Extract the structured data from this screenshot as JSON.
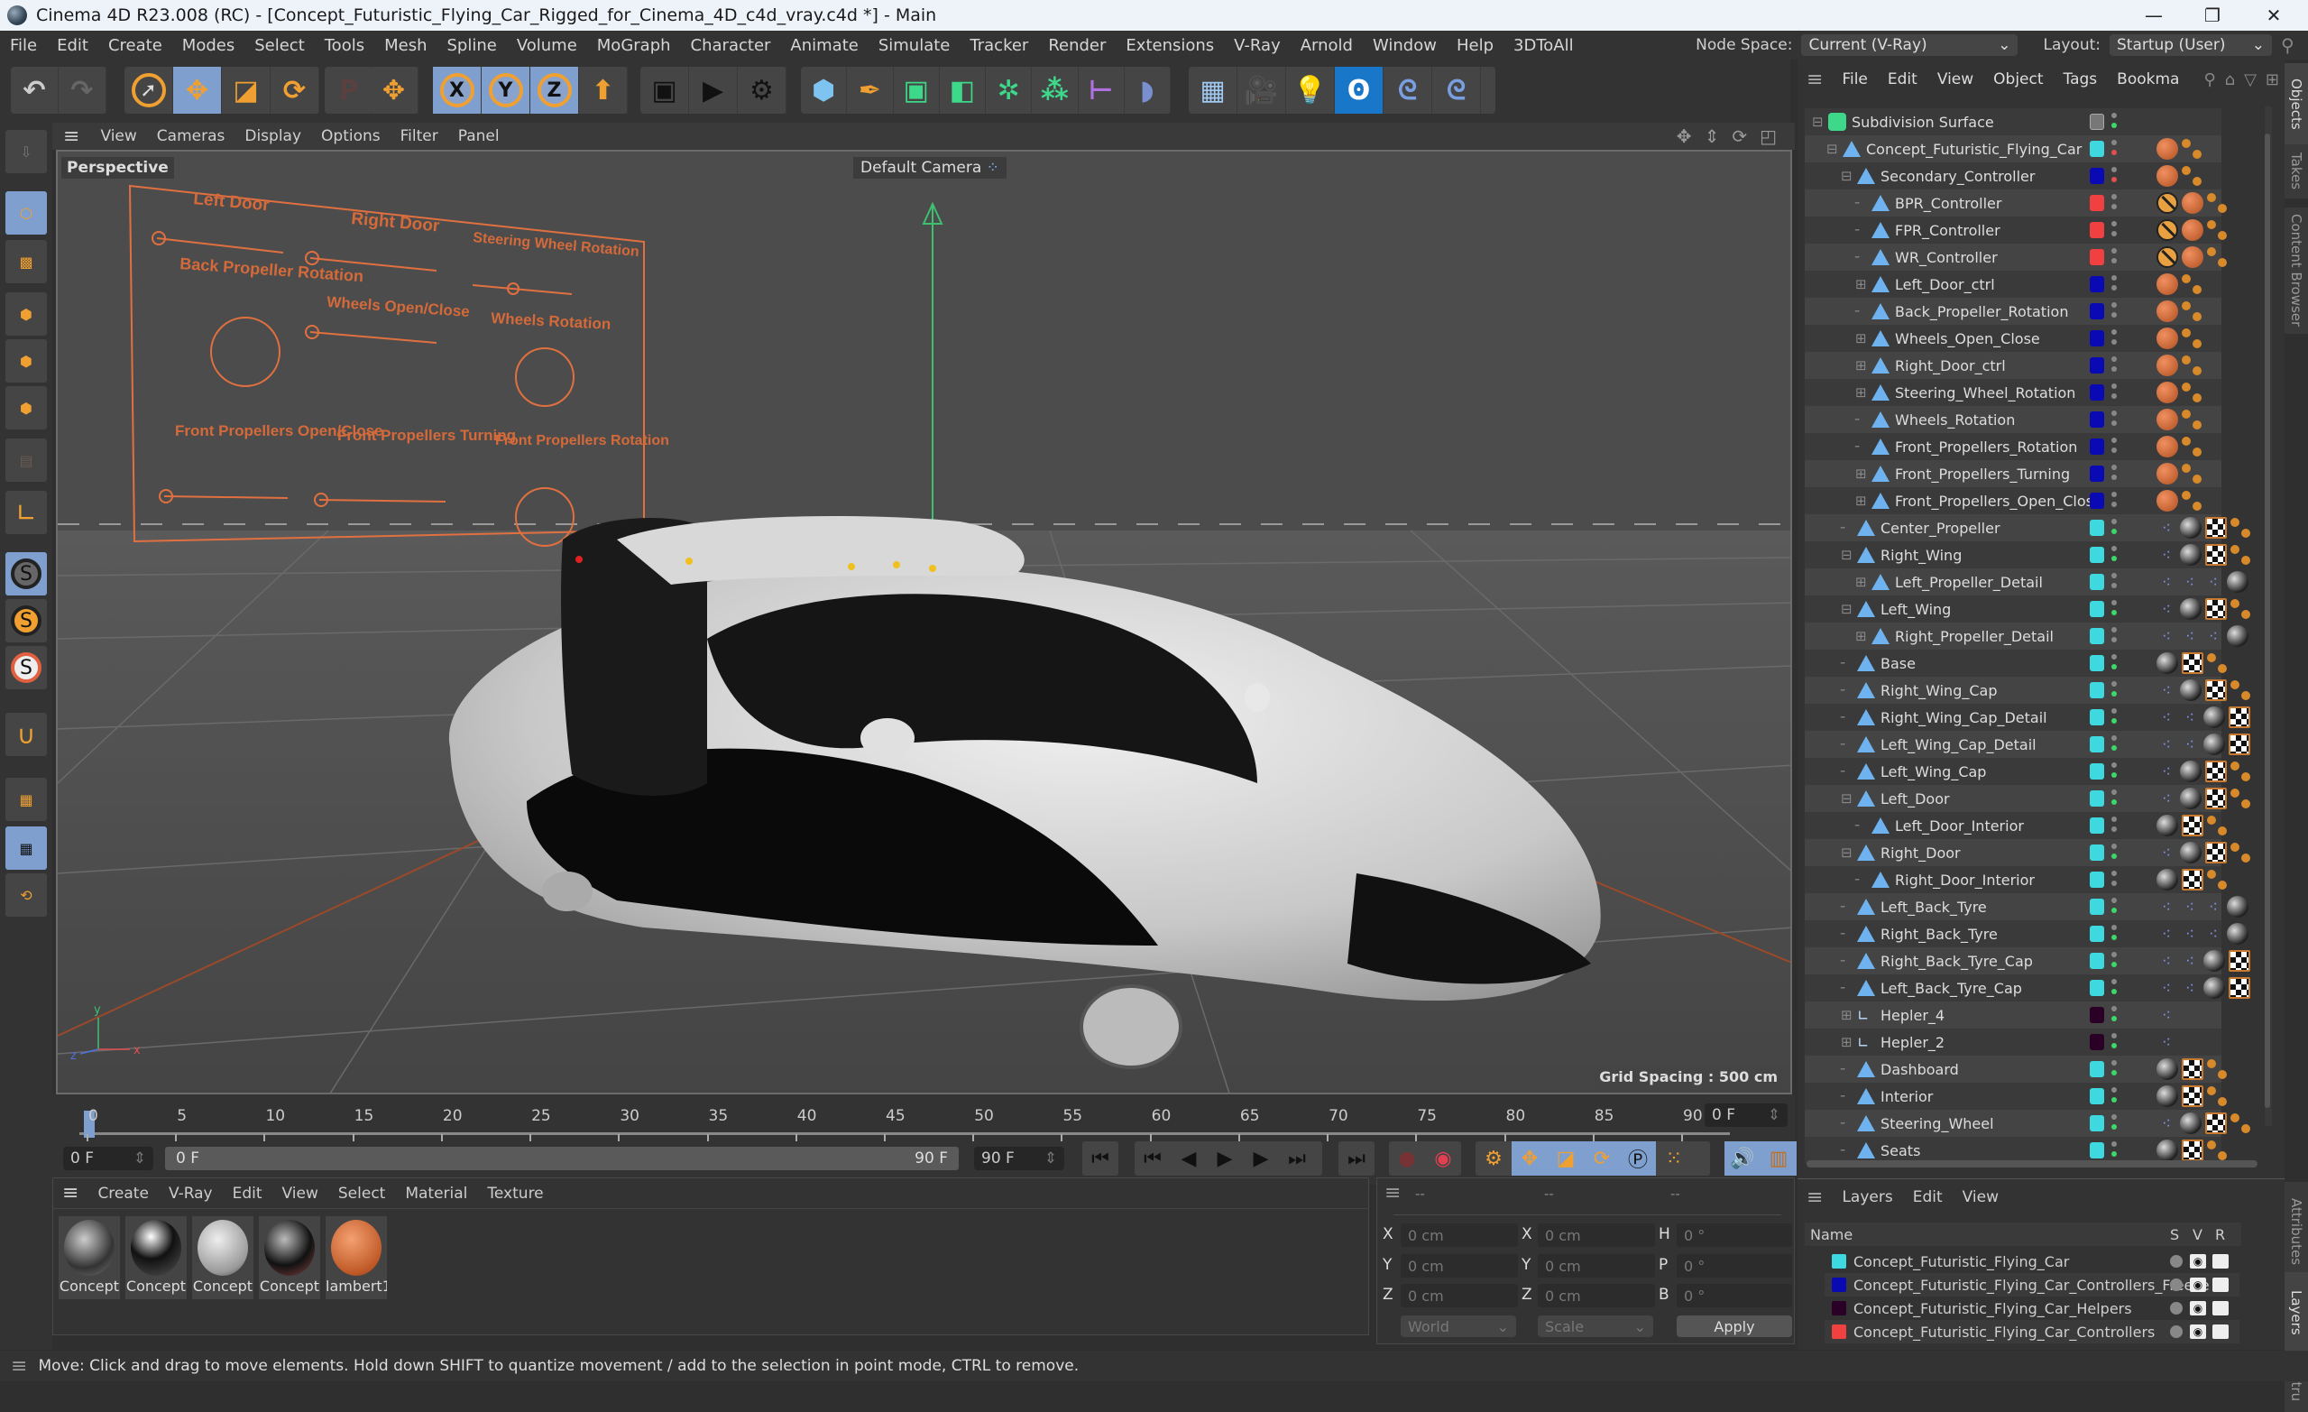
{
  "window": {
    "title": "Cinema 4D R23.008 (RC) - [Concept_Futuristic_Flying_Car_Rigged_for_Cinema_4D_c4d_vray.c4d *] - Main",
    "minimize": "—",
    "restore": "❐",
    "close": "✕"
  },
  "menubar": {
    "items": [
      "File",
      "Edit",
      "Create",
      "Modes",
      "Select",
      "Tools",
      "Mesh",
      "Spline",
      "Volume",
      "MoGraph",
      "Character",
      "Animate",
      "Simulate",
      "Tracker",
      "Render",
      "Extensions",
      "V-Ray",
      "Arnold",
      "Window",
      "Help",
      "3DToAll"
    ],
    "node_space_label": "Node Space:",
    "node_space_value": "Current (V-Ray)",
    "layout_label": "Layout:",
    "layout_value": "Startup (User)"
  },
  "viewport": {
    "menu": [
      "View",
      "Cameras",
      "Display",
      "Options",
      "Filter",
      "Panel"
    ],
    "view_name": "Perspective",
    "camera": "Default Camera",
    "grid_spacing": "Grid Spacing : 500 cm",
    "controller_labels": [
      "Left Door",
      "Right Door",
      "Steering Wheel Rotation",
      "Back Propeller Rotation",
      "Wheels Open/Close",
      "Wheels Rotation",
      "Front Propellers Open/Close",
      "Front Propellers Turning",
      "Front Propellers Rotation"
    ]
  },
  "timeline": {
    "ticks": [
      "0",
      "5",
      "10",
      "15",
      "20",
      "25",
      "30",
      "35",
      "40",
      "45",
      "50",
      "55",
      "60",
      "65",
      "70",
      "75",
      "80",
      "85",
      "90"
    ],
    "current_frame": "0 F",
    "start_field": "0 F",
    "range_start": "0 F",
    "range_end": "90 F",
    "end_field": "90 F",
    "right_field": "0 F"
  },
  "materials": {
    "menu": [
      "Create",
      "V-Ray",
      "Edit",
      "View",
      "Select",
      "Material",
      "Texture"
    ],
    "items": [
      "Concept",
      "Concept",
      "Concept",
      "Concept",
      "lambert1"
    ]
  },
  "coords": {
    "headers": [
      "--",
      "--",
      "--"
    ],
    "pos": {
      "x": "0 cm",
      "y": "0 cm",
      "z": "0 cm"
    },
    "size": {
      "x": "0 cm",
      "y": "0 cm",
      "z": "0 cm"
    },
    "rot": {
      "h": "0 °",
      "p": "0 °",
      "b": "0 °"
    },
    "labels": {
      "x": "X",
      "y": "Y",
      "z": "Z",
      "h": "H",
      "p": "P",
      "b": "B"
    },
    "space": "World",
    "mode": "Scale",
    "apply": "Apply"
  },
  "status": "Move: Click and drag to move elements. Hold down SHIFT to quantize movement / add to the selection in point mode, CTRL to remove.",
  "objects": {
    "menu": [
      "File",
      "Edit",
      "View",
      "Object",
      "Tags",
      "Bookma"
    ],
    "items": [
      {
        "name": "Subdivision Surface",
        "depth": 0,
        "color": "#777777",
        "tags": []
      },
      {
        "name": "Concept_Futuristic_Flying_Car",
        "depth": 1,
        "color": "#3ed8e0",
        "tags": [
          "mat-or",
          "dots"
        ]
      },
      {
        "name": "Secondary_Controller",
        "depth": 2,
        "color": "#0a0ab4",
        "tags": [
          "mat-or",
          "dots"
        ]
      },
      {
        "name": "BPR_Controller",
        "depth": 3,
        "color": "#f04040",
        "tags": [
          "no",
          "mat-or",
          "dots"
        ]
      },
      {
        "name": "FPR_Controller",
        "depth": 3,
        "color": "#f04040",
        "tags": [
          "no",
          "mat-or",
          "dots"
        ]
      },
      {
        "name": "WR_Controller",
        "depth": 3,
        "color": "#f04040",
        "tags": [
          "no",
          "mat-or",
          "dots"
        ]
      },
      {
        "name": "Left_Door_ctrl",
        "depth": 3,
        "color": "#0a0ab4",
        "tags": [
          "mat-or",
          "dots"
        ]
      },
      {
        "name": "Back_Propeller_Rotation",
        "depth": 3,
        "color": "#0a0ab4",
        "tags": [
          "mat-or",
          "dots"
        ]
      },
      {
        "name": "Wheels_Open_Close",
        "depth": 3,
        "color": "#0a0ab4",
        "tags": [
          "mat-or",
          "dots"
        ]
      },
      {
        "name": "Right_Door_ctrl",
        "depth": 3,
        "color": "#0a0ab4",
        "tags": [
          "mat-or",
          "dots"
        ]
      },
      {
        "name": "Steering_Wheel_Rotation",
        "depth": 3,
        "color": "#0a0ab4",
        "tags": [
          "mat-or",
          "dots"
        ]
      },
      {
        "name": "Wheels_Rotation",
        "depth": 3,
        "color": "#0a0ab4",
        "tags": [
          "mat-or",
          "dots"
        ]
      },
      {
        "name": "Front_Propellers_Rotation",
        "depth": 3,
        "color": "#0a0ab4",
        "tags": [
          "mat-or",
          "dots"
        ]
      },
      {
        "name": "Front_Propellers_Turning",
        "depth": 3,
        "color": "#0a0ab4",
        "tags": [
          "mat-or",
          "dots"
        ]
      },
      {
        "name": "Front_Propellers_Open_Close",
        "depth": 3,
        "color": "#0a0ab4",
        "tags": [
          "mat-or",
          "dots"
        ]
      },
      {
        "name": "Center_Propeller",
        "depth": 2,
        "color": "#3ed8e0",
        "tags": [
          "xpr",
          "mat-bw",
          "chk",
          "dots"
        ]
      },
      {
        "name": "Right_Wing",
        "depth": 2,
        "color": "#3ed8e0",
        "tags": [
          "xpr",
          "mat-bw",
          "chk",
          "dots"
        ]
      },
      {
        "name": "Left_Propeller_Detail",
        "depth": 3,
        "color": "#3ed8e0",
        "tags": [
          "xpr",
          "xpr",
          "xpr",
          "mat-bw"
        ]
      },
      {
        "name": "Left_Wing",
        "depth": 2,
        "color": "#3ed8e0",
        "tags": [
          "xpr",
          "mat-bw",
          "chk",
          "dots"
        ]
      },
      {
        "name": "Right_Propeller_Detail",
        "depth": 3,
        "color": "#3ed8e0",
        "tags": [
          "xpr",
          "xpr",
          "xpr",
          "mat-bw"
        ]
      },
      {
        "name": "Base",
        "depth": 2,
        "color": "#3ed8e0",
        "tags": [
          "mat-bw",
          "chk",
          "dots"
        ]
      },
      {
        "name": "Right_Wing_Cap",
        "depth": 2,
        "color": "#3ed8e0",
        "tags": [
          "xpr",
          "mat-bw",
          "chk",
          "dots"
        ]
      },
      {
        "name": "Right_Wing_Cap_Detail",
        "depth": 2,
        "color": "#3ed8e0",
        "tags": [
          "xpr",
          "xpr",
          "mat-bw",
          "chk"
        ]
      },
      {
        "name": "Left_Wing_Cap_Detail",
        "depth": 2,
        "color": "#3ed8e0",
        "tags": [
          "xpr",
          "xpr",
          "mat-bw",
          "chk"
        ]
      },
      {
        "name": "Left_Wing_Cap",
        "depth": 2,
        "color": "#3ed8e0",
        "tags": [
          "xpr",
          "mat-bw",
          "chk",
          "dots"
        ]
      },
      {
        "name": "Left_Door",
        "depth": 2,
        "color": "#3ed8e0",
        "tags": [
          "xpr",
          "mat-bw",
          "chk",
          "dots"
        ]
      },
      {
        "name": "Left_Door_Interior",
        "depth": 3,
        "color": "#3ed8e0",
        "tags": [
          "mat-bw",
          "chk",
          "dots"
        ]
      },
      {
        "name": "Right_Door",
        "depth": 2,
        "color": "#3ed8e0",
        "tags": [
          "xpr",
          "mat-bw",
          "chk",
          "dots"
        ]
      },
      {
        "name": "Right_Door_Interior",
        "depth": 3,
        "color": "#3ed8e0",
        "tags": [
          "mat-bw",
          "chk",
          "dots"
        ]
      },
      {
        "name": "Left_Back_Tyre",
        "depth": 2,
        "color": "#3ed8e0",
        "tags": [
          "xpr",
          "xpr",
          "xpr",
          "mat-bw"
        ]
      },
      {
        "name": "Right_Back_Tyre",
        "depth": 2,
        "color": "#3ed8e0",
        "tags": [
          "xpr",
          "xpr",
          "xpr",
          "mat-bw"
        ]
      },
      {
        "name": "Right_Back_Tyre_Cap",
        "depth": 2,
        "color": "#3ed8e0",
        "tags": [
          "xpr",
          "xpr",
          "mat-bw",
          "chk"
        ]
      },
      {
        "name": "Left_Back_Tyre_Cap",
        "depth": 2,
        "color": "#3ed8e0",
        "tags": [
          "xpr",
          "xpr",
          "mat-bw",
          "chk"
        ]
      },
      {
        "name": "Hepler_4",
        "depth": 2,
        "color": "#2a0026",
        "tags": [
          "xpr"
        ]
      },
      {
        "name": "Hepler_2",
        "depth": 2,
        "color": "#2a0026",
        "tags": [
          "xpr"
        ]
      },
      {
        "name": "Dashboard",
        "depth": 2,
        "color": "#3ed8e0",
        "tags": [
          "mat-bw",
          "chk",
          "dots"
        ]
      },
      {
        "name": "Interior",
        "depth": 2,
        "color": "#3ed8e0",
        "tags": [
          "mat-bw",
          "chk",
          "dots"
        ]
      },
      {
        "name": "Steering_Wheel",
        "depth": 2,
        "color": "#3ed8e0",
        "tags": [
          "xpr",
          "mat-bw",
          "chk",
          "dots"
        ]
      },
      {
        "name": "Seats",
        "depth": 2,
        "color": "#3ed8e0",
        "tags": [
          "mat-bw",
          "chk",
          "dots"
        ]
      }
    ]
  },
  "layers": {
    "menu": [
      "Layers",
      "Edit",
      "View"
    ],
    "columns": [
      "Name",
      "S",
      "V",
      "R"
    ],
    "items": [
      {
        "name": "Concept_Futuristic_Flying_Car",
        "color": "#3ed8e0"
      },
      {
        "name": "Concept_Futuristic_Flying_Car_Controllers_Freeze",
        "color": "#0a0ab4"
      },
      {
        "name": "Concept_Futuristic_Flying_Car_Helpers",
        "color": "#2a0026"
      },
      {
        "name": "Concept_Futuristic_Flying_Car_Controllers",
        "color": "#f04040"
      }
    ]
  },
  "side_tabs": [
    "Objects",
    "Takes",
    "Content Browser",
    "Attributes",
    "Layers",
    "Stru"
  ]
}
